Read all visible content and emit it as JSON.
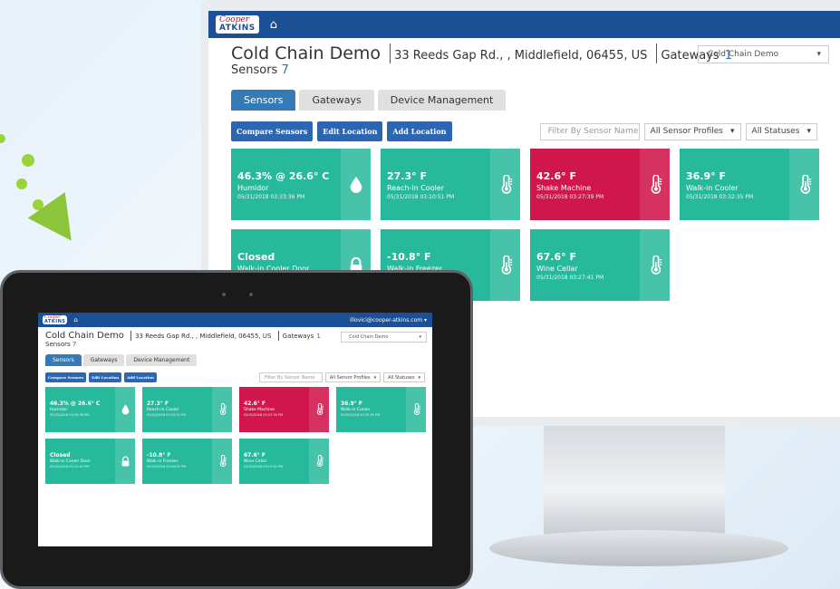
{
  "brand": {
    "logo_top": "Cooper",
    "logo_bottom": "ATKINS",
    "home_icon": "home-icon"
  },
  "user": {
    "email": "illovici@cooper-atkins.com ▾"
  },
  "location": {
    "name": "Cold Chain Demo",
    "address": "33 Reeds Gap Rd., , Middlefield, 06455, US",
    "gateways_label": "Gateways",
    "gateways_count": "1",
    "sensors_label": "Sensors",
    "sensors_count": "7",
    "selector_value": "Cold Chain Demo"
  },
  "tabs": [
    {
      "label": "Sensors",
      "active": true
    },
    {
      "label": "Gateways",
      "active": false
    },
    {
      "label": "Device Management",
      "active": false
    }
  ],
  "actions": {
    "compare": "Compare Sensors",
    "edit": "Edit Location",
    "add": "Add Location"
  },
  "filters": {
    "search_placeholder": "Filter By Sensor Name",
    "profiles": "All Sensor Profiles",
    "statuses": "All Statuses"
  },
  "sensors": [
    {
      "value": "46.3% @ 26.6° C",
      "name": "Humidor",
      "timestamp": "05/31/2018 03:33:36 PM",
      "icon": "droplet-icon",
      "status": "ok"
    },
    {
      "value": "27.3° F",
      "name": "Reach-in Cooler",
      "timestamp": "05/31/2018 03:10:51 PM",
      "icon": "thermometer-icon",
      "status": "ok"
    },
    {
      "value": "42.6° F",
      "name": "Shake Machine",
      "timestamp": "05/31/2018 03:27:39 PM",
      "icon": "thermometer-icon",
      "status": "alert"
    },
    {
      "value": "36.9° F",
      "name": "Walk-in Cooler",
      "timestamp": "05/31/2018 03:32:35 PM",
      "icon": "thermometer-icon",
      "status": "ok"
    },
    {
      "value": "Closed",
      "name": "Walk-in Cooler Door",
      "timestamp": "05/31/2018 03:12:45 PM",
      "icon": "lock-icon",
      "status": "ok"
    },
    {
      "value": "-10.8° F",
      "name": "Walk-in Freezer",
      "timestamp": "05/31/2018 03:09:01 PM",
      "icon": "thermometer-icon",
      "status": "ok"
    },
    {
      "value": "67.6° F",
      "name": "Wine Cellar",
      "timestamp": "05/31/2018 03:27:41 PM",
      "icon": "thermometer-icon",
      "status": "ok"
    }
  ],
  "colors": {
    "topbar": "#1b4f96",
    "ok": "#27b99b",
    "alert": "#d0164c",
    "primary": "#337ab7"
  }
}
